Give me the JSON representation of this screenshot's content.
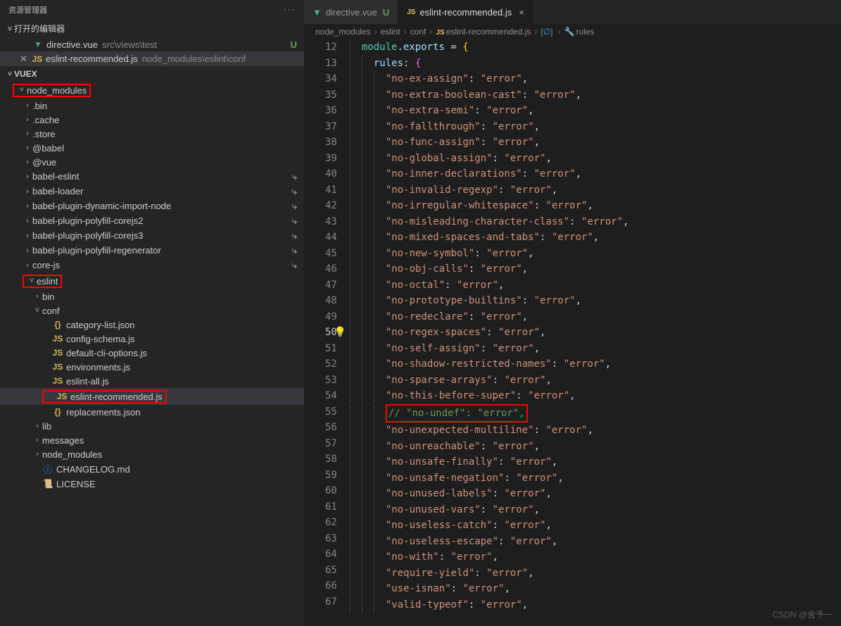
{
  "sidebar": {
    "title": "资源管理器",
    "openEditors": "打开的编辑器",
    "editors": [
      {
        "name": "directive.vue",
        "path": "src\\views\\test",
        "status": "U",
        "icon": "vue",
        "close": false
      },
      {
        "name": "eslint-recommended.js",
        "path": "node_modules\\eslint\\conf",
        "status": "",
        "icon": "js",
        "close": true
      }
    ],
    "project": "VUEX",
    "tree": [
      {
        "d": 0,
        "t": "folder",
        "open": true,
        "name": "node_modules",
        "hl": true
      },
      {
        "d": 1,
        "t": "folder",
        "open": false,
        "name": ".bin"
      },
      {
        "d": 1,
        "t": "folder",
        "open": false,
        "name": ".cache"
      },
      {
        "d": 1,
        "t": "folder",
        "open": false,
        "name": ".store"
      },
      {
        "d": 1,
        "t": "folder",
        "open": false,
        "name": "@babel"
      },
      {
        "d": 1,
        "t": "folder",
        "open": false,
        "name": "@vue"
      },
      {
        "d": 1,
        "t": "folder",
        "open": false,
        "name": "babel-eslint",
        "git": true
      },
      {
        "d": 1,
        "t": "folder",
        "open": false,
        "name": "babel-loader",
        "git": true
      },
      {
        "d": 1,
        "t": "folder",
        "open": false,
        "name": "babel-plugin-dynamic-import-node",
        "git": true
      },
      {
        "d": 1,
        "t": "folder",
        "open": false,
        "name": "babel-plugin-polyfill-corejs2",
        "git": true
      },
      {
        "d": 1,
        "t": "folder",
        "open": false,
        "name": "babel-plugin-polyfill-corejs3",
        "git": true
      },
      {
        "d": 1,
        "t": "folder",
        "open": false,
        "name": "babel-plugin-polyfill-regenerator",
        "git": true
      },
      {
        "d": 1,
        "t": "folder",
        "open": false,
        "name": "core-js",
        "git": true
      },
      {
        "d": 1,
        "t": "folder",
        "open": true,
        "name": "eslint",
        "hl": true
      },
      {
        "d": 2,
        "t": "folder",
        "open": false,
        "name": "bin"
      },
      {
        "d": 2,
        "t": "folder",
        "open": true,
        "name": "conf"
      },
      {
        "d": 3,
        "t": "file",
        "icon": "json",
        "name": "category-list.json"
      },
      {
        "d": 3,
        "t": "file",
        "icon": "js",
        "name": "config-schema.js"
      },
      {
        "d": 3,
        "t": "file",
        "icon": "js",
        "name": "default-cli-options.js"
      },
      {
        "d": 3,
        "t": "file",
        "icon": "js",
        "name": "environments.js"
      },
      {
        "d": 3,
        "t": "file",
        "icon": "js",
        "name": "eslint-all.js"
      },
      {
        "d": 3,
        "t": "file",
        "icon": "js",
        "name": "eslint-recommended.js",
        "hl": true,
        "sel": true
      },
      {
        "d": 3,
        "t": "file",
        "icon": "json",
        "name": "replacements.json"
      },
      {
        "d": 2,
        "t": "folder",
        "open": false,
        "name": "lib"
      },
      {
        "d": 2,
        "t": "folder",
        "open": false,
        "name": "messages"
      },
      {
        "d": 2,
        "t": "folder",
        "open": false,
        "name": "node_modules"
      },
      {
        "d": 2,
        "t": "file",
        "icon": "info",
        "name": "CHANGELOG.md"
      },
      {
        "d": 2,
        "t": "file",
        "icon": "cert",
        "name": "LICENSE"
      }
    ]
  },
  "tabs": [
    {
      "name": "directive.vue",
      "icon": "vue",
      "status": "U",
      "active": false
    },
    {
      "name": "eslint-recommended.js",
      "icon": "js",
      "status": "×",
      "active": true
    }
  ],
  "breadcrumb": [
    {
      "text": "node_modules"
    },
    {
      "text": "eslint"
    },
    {
      "text": "conf"
    },
    {
      "text": "eslint-recommended.js",
      "icon": "js"
    },
    {
      "text": "<unknown>",
      "icon": "cube"
    },
    {
      "text": "rules",
      "icon": "wrench"
    }
  ],
  "code": {
    "head": [
      {
        "n": 12,
        "t": "module_exports"
      },
      {
        "n": 13,
        "t": "rules"
      }
    ],
    "rules": [
      {
        "n": 34,
        "k": "no-ex-assign",
        "v": "error"
      },
      {
        "n": 35,
        "k": "no-extra-boolean-cast",
        "v": "error"
      },
      {
        "n": 36,
        "k": "no-extra-semi",
        "v": "error"
      },
      {
        "n": 37,
        "k": "no-fallthrough",
        "v": "error"
      },
      {
        "n": 38,
        "k": "no-func-assign",
        "v": "error"
      },
      {
        "n": 39,
        "k": "no-global-assign",
        "v": "error"
      },
      {
        "n": 40,
        "k": "no-inner-declarations",
        "v": "error"
      },
      {
        "n": 41,
        "k": "no-invalid-regexp",
        "v": "error"
      },
      {
        "n": 42,
        "k": "no-irregular-whitespace",
        "v": "error"
      },
      {
        "n": 43,
        "k": "no-misleading-character-class",
        "v": "error"
      },
      {
        "n": 44,
        "k": "no-mixed-spaces-and-tabs",
        "v": "error"
      },
      {
        "n": 45,
        "k": "no-new-symbol",
        "v": "error"
      },
      {
        "n": 46,
        "k": "no-obj-calls",
        "v": "error"
      },
      {
        "n": 47,
        "k": "no-octal",
        "v": "error"
      },
      {
        "n": 48,
        "k": "no-prototype-builtins",
        "v": "error"
      },
      {
        "n": 49,
        "k": "no-redeclare",
        "v": "error"
      },
      {
        "n": 50,
        "k": "no-regex-spaces",
        "v": "error",
        "bulb": true,
        "cur": true
      },
      {
        "n": 51,
        "k": "no-self-assign",
        "v": "error"
      },
      {
        "n": 52,
        "k": "no-shadow-restricted-names",
        "v": "error"
      },
      {
        "n": 53,
        "k": "no-sparse-arrays",
        "v": "error"
      },
      {
        "n": 54,
        "k": "no-this-before-super",
        "v": "error"
      },
      {
        "n": 55,
        "comment": "// \"no-undef\": \"error\",",
        "hl": true
      },
      {
        "n": 56,
        "k": "no-unexpected-multiline",
        "v": "error"
      },
      {
        "n": 57,
        "k": "no-unreachable",
        "v": "error"
      },
      {
        "n": 58,
        "k": "no-unsafe-finally",
        "v": "error"
      },
      {
        "n": 59,
        "k": "no-unsafe-negation",
        "v": "error"
      },
      {
        "n": 60,
        "k": "no-unused-labels",
        "v": "error"
      },
      {
        "n": 61,
        "k": "no-unused-vars",
        "v": "error"
      },
      {
        "n": 62,
        "k": "no-useless-catch",
        "v": "error"
      },
      {
        "n": 63,
        "k": "no-useless-escape",
        "v": "error"
      },
      {
        "n": 64,
        "k": "no-with",
        "v": "error"
      },
      {
        "n": 65,
        "k": "require-yield",
        "v": "error"
      },
      {
        "n": 66,
        "k": "use-isnan",
        "v": "error"
      },
      {
        "n": 67,
        "k": "valid-typeof",
        "v": "error"
      }
    ]
  },
  "watermark": "CSDN @舍予一"
}
